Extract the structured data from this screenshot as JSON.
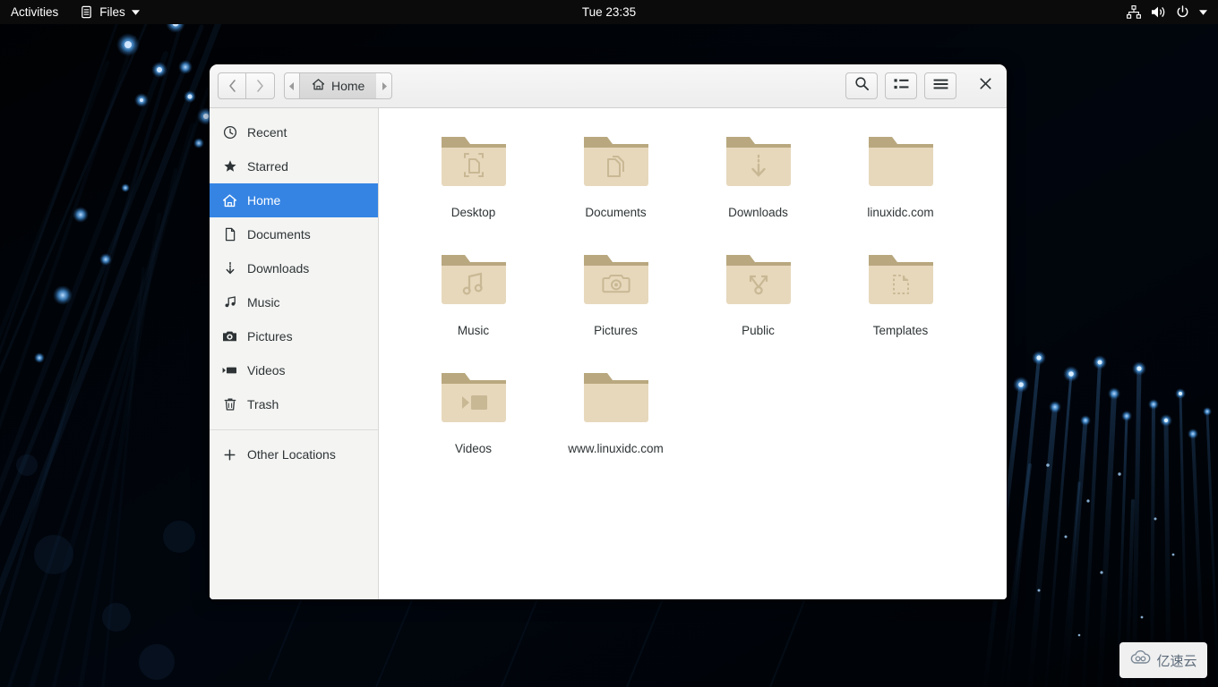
{
  "topbar": {
    "activities": "Activities",
    "app_name": "Files",
    "app_icon": "files-icon",
    "app_menu_arrow": "chevron-down-icon",
    "clock": "Tue 23:35",
    "system_icons": [
      "network-icon",
      "volume-icon",
      "power-icon",
      "chevron-down-icon"
    ],
    "background": "#0b0b0b"
  },
  "window": {
    "headerbar": {
      "back_label": "‹",
      "forward_label": "›",
      "pathbar": {
        "prev_arrow": "◂",
        "next_arrow": "▸",
        "crumb_icon": "home-icon",
        "crumb_label": "Home"
      },
      "search_icon": "search-icon",
      "view_toggle_icon": "list-view-icon",
      "menu_icon": "hamburger-menu-icon",
      "close_icon": "close-icon"
    },
    "sidebar": {
      "items": [
        {
          "label": "Recent",
          "icon": "clock-icon",
          "selected": false
        },
        {
          "label": "Starred",
          "icon": "star-icon",
          "selected": false
        },
        {
          "label": "Home",
          "icon": "home-icon",
          "selected": true
        },
        {
          "label": "Documents",
          "icon": "document-icon",
          "selected": false
        },
        {
          "label": "Downloads",
          "icon": "download-icon",
          "selected": false
        },
        {
          "label": "Music",
          "icon": "music-icon",
          "selected": false
        },
        {
          "label": "Pictures",
          "icon": "camera-icon",
          "selected": false
        },
        {
          "label": "Videos",
          "icon": "video-icon",
          "selected": false
        },
        {
          "label": "Trash",
          "icon": "trash-icon",
          "selected": false
        }
      ],
      "other_locations": {
        "label": "Other Locations",
        "icon": "plus-icon"
      },
      "selection_color": "#3584e4"
    },
    "files": [
      {
        "name": "Desktop",
        "icon": "folder-desktop"
      },
      {
        "name": "Documents",
        "icon": "folder-documents"
      },
      {
        "name": "Downloads",
        "icon": "folder-downloads"
      },
      {
        "name": "linuxidc.com",
        "icon": "folder-plain"
      },
      {
        "name": "Music",
        "icon": "folder-music"
      },
      {
        "name": "Pictures",
        "icon": "folder-pictures"
      },
      {
        "name": "Public",
        "icon": "folder-public"
      },
      {
        "name": "Templates",
        "icon": "folder-templates"
      },
      {
        "name": "Videos",
        "icon": "folder-videos"
      },
      {
        "name": "www.linuxidc.com",
        "icon": "folder-plain"
      }
    ],
    "folder_colors": {
      "front": "#e7d8bc",
      "back": "#b9a87f",
      "emblem": "#c9b894"
    }
  },
  "watermark": {
    "text": "亿速云",
    "icon": "cloud-logo-icon"
  }
}
